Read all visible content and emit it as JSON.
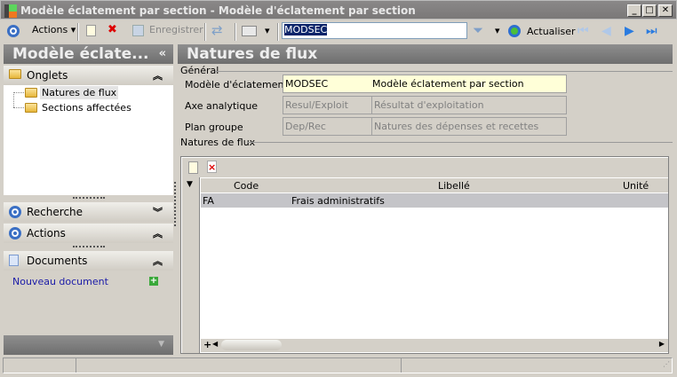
{
  "window": {
    "title": "Modèle éclatement par section -  Modèle d'éclatement par section",
    "minimize": "_",
    "maximize": "□",
    "close": "✕"
  },
  "toolbar": {
    "actions": "Actions",
    "save": "Enregistrer",
    "search_value": "MODSEC",
    "refresh": "Actualiser"
  },
  "left_panel": {
    "title": "Modèle éclate...",
    "collapse": "«",
    "onglets": {
      "label": "Onglets",
      "items": [
        "Natures de flux",
        "Sections affectées"
      ]
    },
    "recherche": "Recherche",
    "actions": "Actions",
    "documents": {
      "label": "Documents",
      "new_doc": "Nouveau document"
    }
  },
  "main": {
    "title": "Natures de flux",
    "general": {
      "legend": "Général",
      "fields": [
        {
          "label": "Modèle d'éclatement",
          "code": "MODSEC",
          "desc": "Modèle éclatement par section"
        },
        {
          "label": "Axe analytique",
          "code": "Resul/Exploit",
          "desc": "Résultat d'exploitation"
        },
        {
          "label": "Plan groupe",
          "code": "Dep/Rec",
          "desc": "Natures des dépenses et recettes"
        }
      ]
    },
    "grid": {
      "legend": "Natures de flux",
      "columns": [
        "Code",
        "Libellé",
        "Unité"
      ],
      "rows": [
        {
          "code": "FA",
          "libelle": "Frais administratifs",
          "unite": ""
        }
      ],
      "add": "+"
    }
  }
}
